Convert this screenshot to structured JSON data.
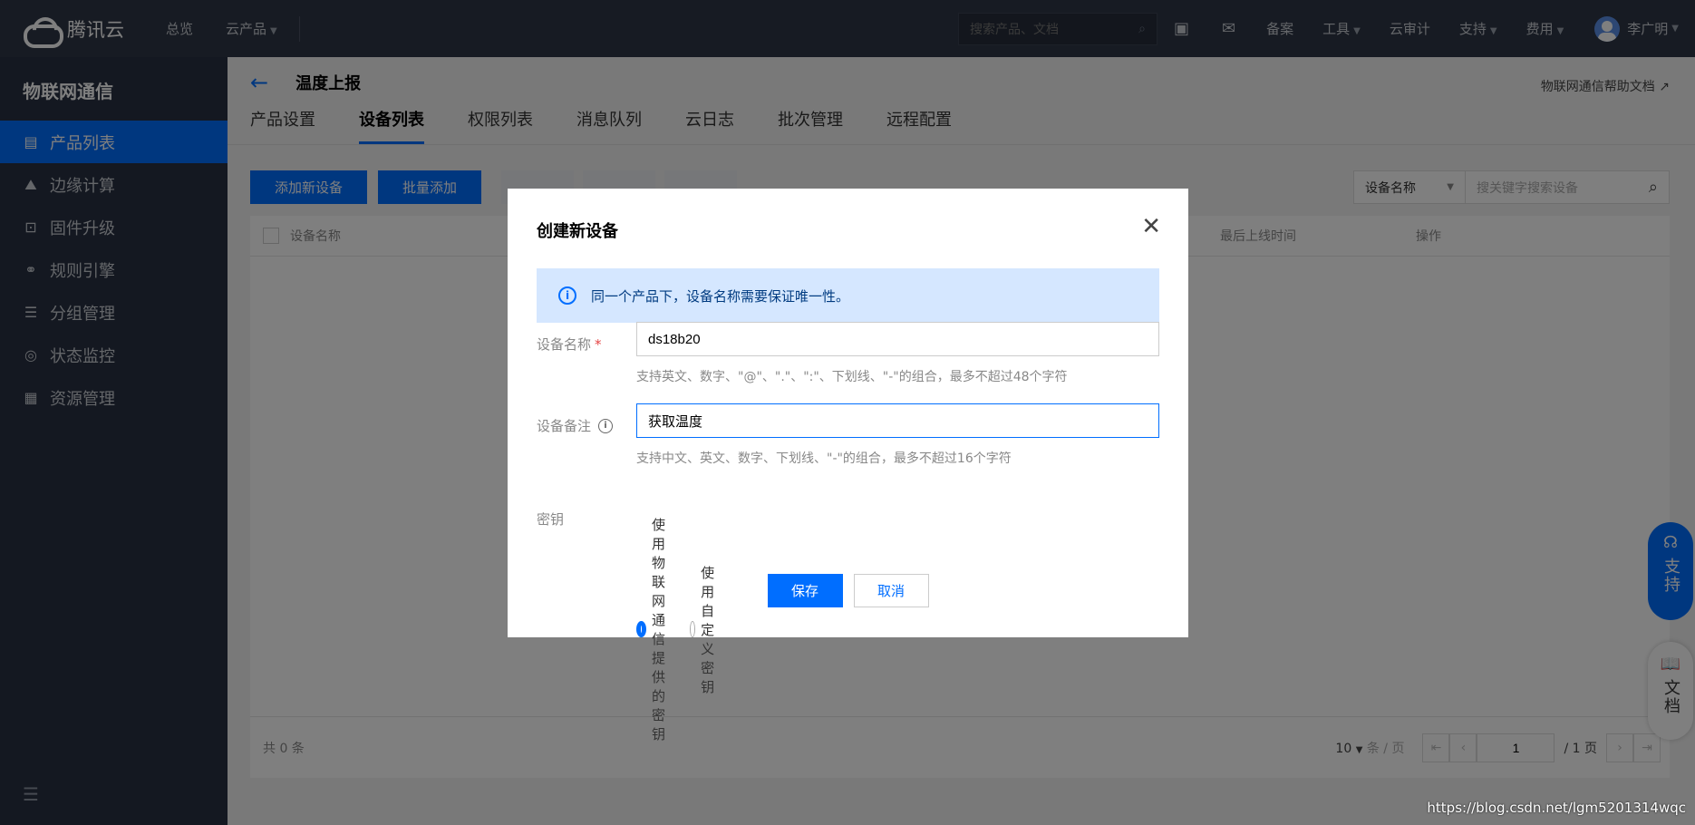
{
  "topbar": {
    "brand": "腾讯云",
    "nav": [
      {
        "label": "总览"
      },
      {
        "label": "云产品",
        "caret": true
      }
    ],
    "search_placeholder": "搜索产品、文档",
    "links": [
      {
        "label": "备案",
        "caret": false
      },
      {
        "label": "工具",
        "caret": true
      },
      {
        "label": "云审计",
        "caret": false
      },
      {
        "label": "支持",
        "caret": true
      },
      {
        "label": "费用",
        "caret": true
      }
    ],
    "user": "李广明"
  },
  "sidebar": {
    "title": "物联网通信",
    "items": [
      {
        "label": "产品列表",
        "icon": "list-icon",
        "glyph": "▤",
        "active": true
      },
      {
        "label": "边缘计算",
        "icon": "edge-compute-icon",
        "glyph": "⛰",
        "active": false
      },
      {
        "label": "固件升级",
        "icon": "firmware-upgrade-icon",
        "glyph": "⊡",
        "active": false
      },
      {
        "label": "规则引擎",
        "icon": "link-icon",
        "glyph": "⚭",
        "active": false
      },
      {
        "label": "分组管理",
        "icon": "group-icon",
        "glyph": "☰",
        "active": false
      },
      {
        "label": "状态监控",
        "icon": "monitor-icon",
        "glyph": "◎",
        "active": false
      },
      {
        "label": "资源管理",
        "icon": "resource-icon",
        "glyph": "▦",
        "active": false
      }
    ]
  },
  "page": {
    "title": "温度上报",
    "help_link": "物联网通信帮助文档",
    "tabs": [
      {
        "label": "产品设置",
        "active": false
      },
      {
        "label": "设备列表",
        "active": true
      },
      {
        "label": "权限列表",
        "active": false
      },
      {
        "label": "消息队列",
        "active": false
      },
      {
        "label": "云日志",
        "active": false
      },
      {
        "label": "批次管理",
        "active": false
      },
      {
        "label": "远程配置",
        "active": false
      }
    ],
    "toolbar": {
      "add_device": "添加新设备",
      "batch_add": "批量添加"
    },
    "filter": {
      "select_value": "设备名称",
      "search_placeholder": "搜关键字搜索设备"
    },
    "table": {
      "col_name": "设备名称",
      "col_last_online": "最后上线时间",
      "col_ops": "操作",
      "total": "共 0 条",
      "page_size": "10",
      "per_page": "条 / 页",
      "page_num": "1",
      "page_total": "/ 1 页"
    }
  },
  "modal": {
    "title": "创建新设备",
    "notice": "同一个产品下，设备名称需要保证唯一性。",
    "name_label": "设备名称",
    "name_value": "ds18b20",
    "name_hint": "支持英文、数字、\"@\"、\".\"、\":\"、下划线、\"-\"的组合，最多不超过48个字符",
    "remark_label": "设备备注",
    "remark_value": "获取温度",
    "remark_hint": "支持中文、英文、数字、下划线、\"-\"的组合，最多不超过16个字符",
    "key_label": "密钥",
    "key_option_1": "使用物联网通信提供的密钥",
    "key_option_2": "使用自定义密钥",
    "save": "保存",
    "cancel": "取消"
  },
  "float": {
    "support": "支持",
    "docs": "文档"
  },
  "watermark": "https://blog.csdn.net/lgm5201314wqc",
  "colors": {
    "accent": "#006eff",
    "topbar": "#2f3746",
    "sidebar": "#293142",
    "notice_bg": "#d5e7ff"
  }
}
